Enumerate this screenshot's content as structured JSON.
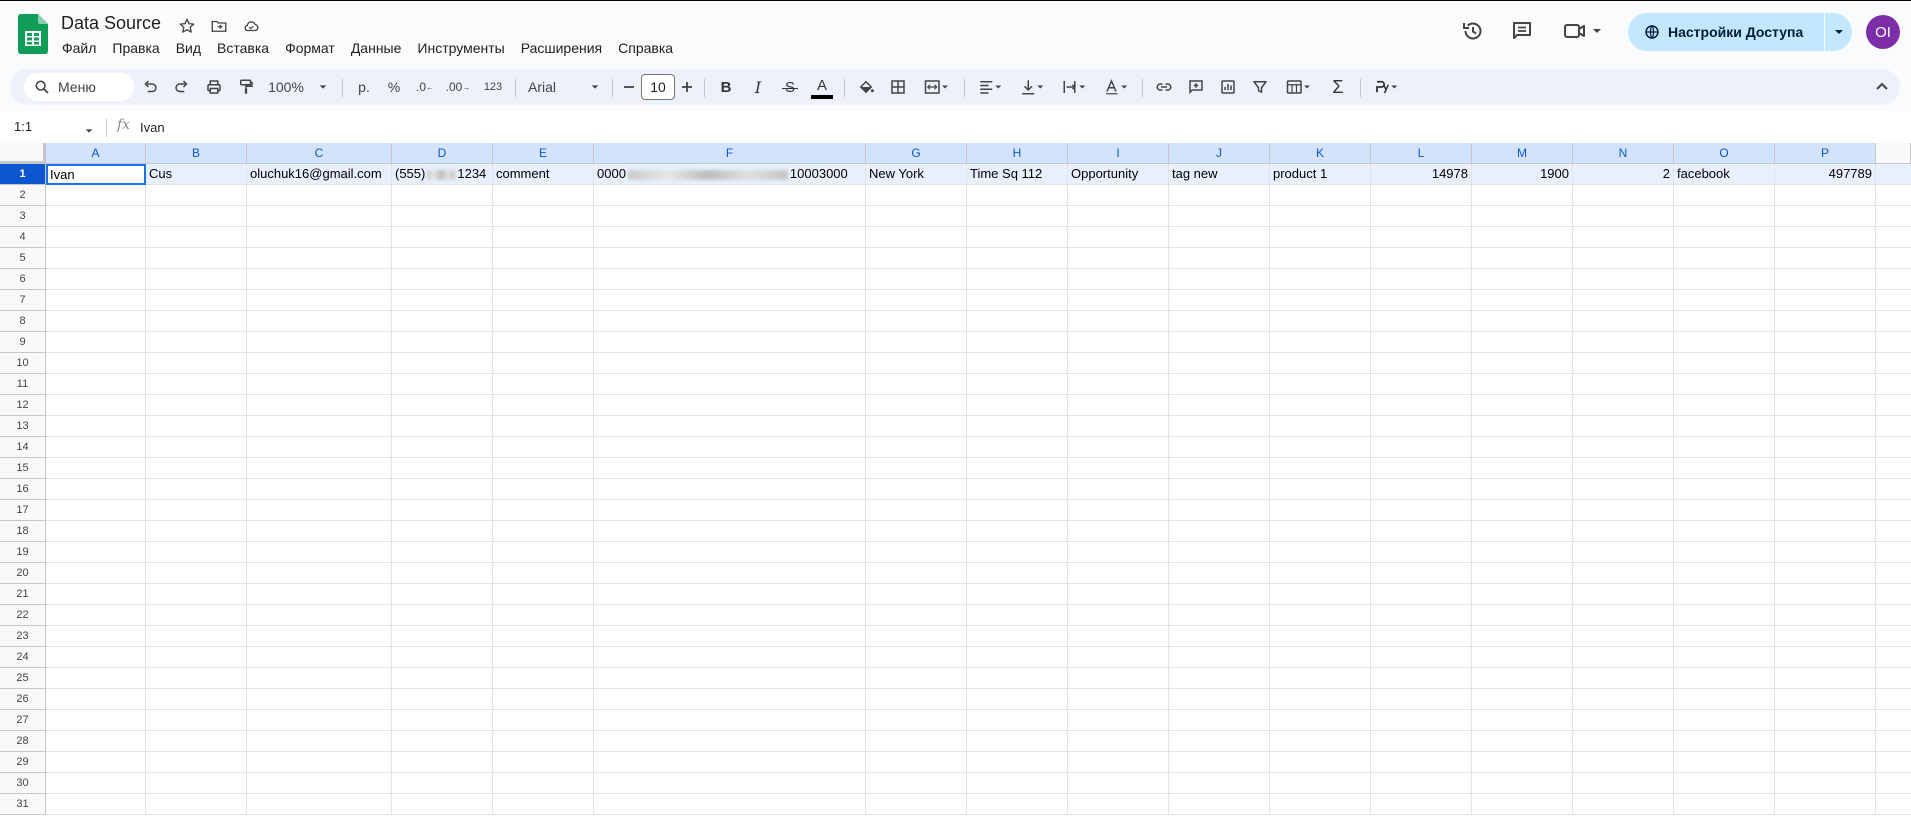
{
  "app": {
    "doc_title": "Data Source",
    "menu": [
      "Файл",
      "Правка",
      "Вид",
      "Вставка",
      "Формат",
      "Данные",
      "Инструменты",
      "Расширения",
      "Справка"
    ],
    "share_label": "Настройки Доступа",
    "avatar_initials": "OI",
    "brand_color": "#0f9d58"
  },
  "toolbar": {
    "search_label": "Меню",
    "zoom": "100%",
    "currency": "р.",
    "percent": "%",
    "decrease_decimal": ".0",
    "increase_decimal": ".00",
    "number_format": "123",
    "font": "Arial",
    "font_size": "10"
  },
  "formula_bar": {
    "name_box": "1:1",
    "fx": "fx",
    "value": "Ivan"
  },
  "sheet": {
    "columns": [
      "A",
      "B",
      "C",
      "D",
      "E",
      "F",
      "G",
      "H",
      "I",
      "J",
      "K",
      "L",
      "M",
      "N",
      "O",
      "P"
    ],
    "row_numbers": [
      "1",
      "2",
      "3",
      "4",
      "5",
      "6",
      "7",
      "8",
      "9",
      "10",
      "11",
      "12",
      "13",
      "14",
      "15",
      "16",
      "17",
      "18",
      "19",
      "20",
      "21",
      "22",
      "23",
      "24",
      "25",
      "26",
      "27",
      "28",
      "29",
      "30",
      "31"
    ],
    "row1": [
      {
        "v": "Ivan",
        "num": false
      },
      {
        "v": "Cus",
        "num": false
      },
      {
        "v": "oluchuk16@gmail.com",
        "num": false
      },
      {
        "v": "(555)",
        "tail": "1234",
        "blur": true,
        "num": false
      },
      {
        "v": "comment",
        "num": false
      },
      {
        "v": "0000",
        "tail": "10003000",
        "blur": true,
        "num": false
      },
      {
        "v": "New York",
        "num": false
      },
      {
        "v": "Time Sq 112",
        "num": false
      },
      {
        "v": "Opportunity",
        "num": false
      },
      {
        "v": "tag new",
        "num": false
      },
      {
        "v": "product 1",
        "num": false
      },
      {
        "v": "14978",
        "num": true
      },
      {
        "v": "1900",
        "num": true
      },
      {
        "v": "2",
        "num": true
      },
      {
        "v": "facebook",
        "num": false
      },
      {
        "v": "497789",
        "num": true
      }
    ]
  }
}
